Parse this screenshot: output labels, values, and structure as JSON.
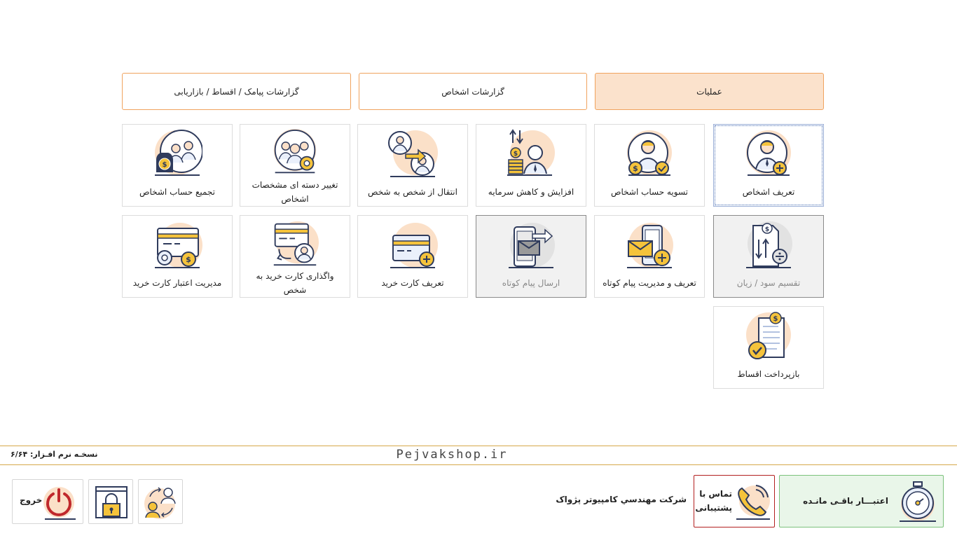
{
  "tabs": [
    {
      "label": "عملیات",
      "active": true
    },
    {
      "label": "گزارشات اشخاص",
      "active": false
    },
    {
      "label": "گزارشات پیامک / اقساط / بازاریابی",
      "active": false
    }
  ],
  "tiles": [
    {
      "label": "تعریف اشخاص",
      "icon": "person-add-icon",
      "state": "selected"
    },
    {
      "label": "تسویه حساب اشخاص",
      "icon": "person-settle-icon",
      "state": "normal"
    },
    {
      "label": "افزایش و کاهش سرمایه",
      "icon": "capital-change-icon",
      "state": "normal"
    },
    {
      "label": "انتقال از شخص به شخص",
      "icon": "transfer-person-icon",
      "state": "normal"
    },
    {
      "label": "تغییر دسته ای مشخصات اشخاص",
      "icon": "group-settings-icon",
      "state": "normal"
    },
    {
      "label": "تجمیع حساب اشخاص",
      "icon": "merge-accounts-icon",
      "state": "normal"
    },
    {
      "label": "تقسیم سود / زیان",
      "icon": "profit-split-icon",
      "state": "disabled"
    },
    {
      "label": "تعریف و مدیریت پیام کوتاه",
      "icon": "sms-manage-icon",
      "state": "normal"
    },
    {
      "label": "ارسال پیام کوتاه",
      "icon": "sms-send-icon",
      "state": "disabled"
    },
    {
      "label": "تعریف کارت خرید",
      "icon": "card-add-icon",
      "state": "normal"
    },
    {
      "label": "واگذاری کارت خرید به شخص",
      "icon": "card-assign-icon",
      "state": "normal"
    },
    {
      "label": "مدیریت اعتبار کارت خرید",
      "icon": "card-credit-icon",
      "state": "normal"
    },
    {
      "label": "بازپرداخت اقساط",
      "icon": "installment-icon",
      "state": "normal"
    }
  ],
  "footer": {
    "site": "Pejvakshop.ir",
    "version": "نسخـه نرم افـزار: ۶/۶۴",
    "credit_label": "اعتبـــار باقـی مانـده",
    "support_label": "تماس با پشتیبانی",
    "company": "شرکت مهندسي کامپيوتر پژواک",
    "exit_label": "خروج"
  },
  "colors": {
    "accent": "#f0a35e",
    "accent_bg": "#fbe2cc",
    "icon_circle": "#fbe0c8",
    "icon_stroke": "#2f3b5c",
    "icon_fill": "#eaf0fb",
    "gold": "#f5c33b",
    "credit_bg": "#e9f6e9",
    "support_border": "#b32020"
  }
}
